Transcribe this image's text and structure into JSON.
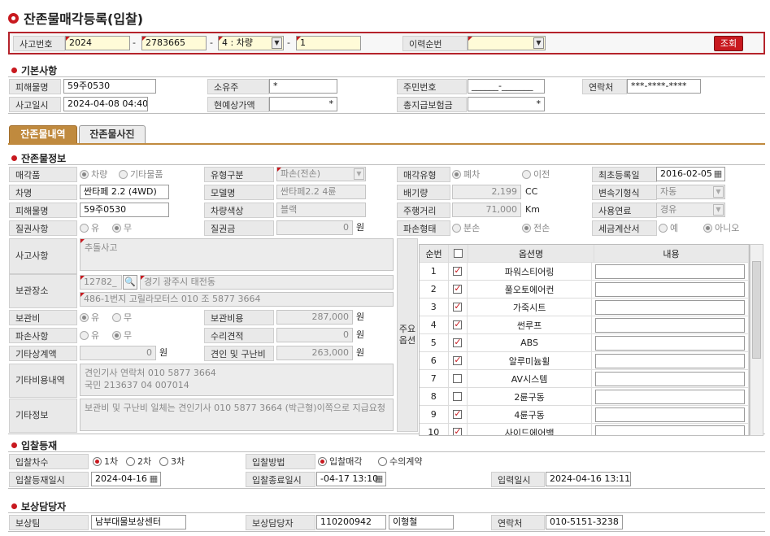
{
  "page_title": "잔존물매각등록(입찰)",
  "search": {
    "label_accident_no": "사고번호",
    "year": "2024",
    "sep1": "-",
    "accident_no": "2783665",
    "sep2": "-",
    "type_select": "4 : 차량",
    "sep3": "-",
    "seq": "1",
    "label_history": "이력순번",
    "history_select": "",
    "search_button": "조회"
  },
  "basic": {
    "section_title": "기본사항",
    "victim_item_label": "피해물명",
    "victim_item": "59주0530",
    "owner_label": "소유주",
    "owner": "*",
    "resident_no_label": "주민번호",
    "resident_no": "______-_______",
    "contact_label": "연락처",
    "contact": "***-****-****",
    "accident_date_label": "사고일시",
    "accident_date": "2024-04-08 04:40",
    "present_value_label": "현예상가액",
    "present_value": "*",
    "total_paid_label": "총지급보험금",
    "total_paid": "*"
  },
  "tabs": [
    {
      "label": "잔존물내역"
    },
    {
      "label": "잔존물사진"
    }
  ],
  "salvage": {
    "section_title": "잔존물정보",
    "sale_item_label": "매각품",
    "sale_item_opt1": "차량",
    "sale_item_opt2": "기타물품",
    "type_label": "유형구분",
    "type_value": "파손(전손)",
    "sale_type_label": "매각유형",
    "sale_type_opt1": "폐차",
    "sale_type_opt2": "이전",
    "first_reg_label": "최초등록일",
    "first_reg": "2016-02-05",
    "car_name_label": "차명",
    "car_name": "싼타페 2.2 (4WD)",
    "model_label": "모델명",
    "model": "싼타페2.2 4륜",
    "displacement_label": "배기량",
    "displacement": "2,199",
    "displacement_unit": "CC",
    "transmission_label": "변속기형식",
    "transmission": "자동",
    "victim_item_label": "피해물명",
    "victim_item": "59주0530",
    "color_label": "차량색상",
    "color": "블랙",
    "mileage_label": "주행거리",
    "mileage": "71,000",
    "mileage_unit": "Km",
    "fuel_label": "사용연료",
    "fuel": "경유",
    "lien_label": "질권사항",
    "lien_opt1": "유",
    "lien_opt2": "무",
    "lien_amount_label": "질권금",
    "lien_amount": "0",
    "won": "원",
    "damage_form_label": "파손형태",
    "damage_form_opt1": "분손",
    "damage_form_opt2": "전손",
    "tax_invoice_label": "세금계산서",
    "tax_invoice_opt1": "예",
    "tax_invoice_opt2": "아니오",
    "accident_desc_label": "사고사항",
    "accident_desc": "추돌사고",
    "storage_label": "보관장소",
    "zip": "12782_",
    "addr1": "경기 광주시 태전동",
    "addr2": "486-1번지 고릴라모터스 010 조 5877 3664",
    "storage_fee_label": "보관비",
    "storage_fee_opt1": "유",
    "storage_fee_opt2": "무",
    "storage_cost_label": "보관비용",
    "storage_cost": "287,000",
    "damage_label": "파손사항",
    "damage_opt1": "유",
    "damage_opt2": "무",
    "repair_est_label": "수리견적",
    "repair_est": "0",
    "other_total_label": "기타상계액",
    "other_total": "0",
    "tow_label": "견인 및 구난비",
    "tow_cost": "263,000",
    "other_cost_label": "기타비용내역",
    "other_cost": "견인기사 연락처 010 5877 3664\n국민 213637 04 007014",
    "other_info_label": "기타정보",
    "other_info": "보관비 및 구난비 일체는 견인기사 010 5877 3664 (박근형)이쪽으로 지급요청"
  },
  "options": {
    "vertical_label": "주요옵션",
    "header_no": "순번",
    "header_name": "옵션명",
    "header_content": "내용",
    "rows": [
      {
        "no": "1",
        "name": "파워스티어링",
        "checked": true
      },
      {
        "no": "2",
        "name": "풀오토에어컨",
        "checked": true
      },
      {
        "no": "3",
        "name": "가죽시트",
        "checked": true
      },
      {
        "no": "4",
        "name": "썬루프",
        "checked": true
      },
      {
        "no": "5",
        "name": "ABS",
        "checked": true
      },
      {
        "no": "6",
        "name": "알루미늄휠",
        "checked": true
      },
      {
        "no": "7",
        "name": "AV시스템",
        "checked": false
      },
      {
        "no": "8",
        "name": "2륜구동",
        "checked": false
      },
      {
        "no": "9",
        "name": "4륜구동",
        "checked": true
      },
      {
        "no": "10",
        "name": "사이드에어백",
        "checked": true
      }
    ]
  },
  "bid": {
    "section_title": "입찰등재",
    "round_label": "입찰차수",
    "round_opt1": "1차",
    "round_opt2": "2차",
    "round_opt3": "3차",
    "method_label": "입찰방법",
    "method_opt1": "입찰매각",
    "method_opt2": "수의계약",
    "reg_date_label": "입찰등재일시",
    "reg_date": "2024-04-16",
    "end_date_label": "입찰종료일시",
    "end_date": "-04-17 13:10",
    "input_date_label": "입력일시",
    "input_date": "2024-04-16 13:11"
  },
  "compensation": {
    "section_title": "보상담당자",
    "team_label": "보상팀",
    "team": "남부대물보상센터",
    "manager_label": "보상담당자",
    "manager_id": "110200942",
    "manager_name": "이형철",
    "contact_label": "연락처",
    "contact": "010-5151-3238"
  }
}
